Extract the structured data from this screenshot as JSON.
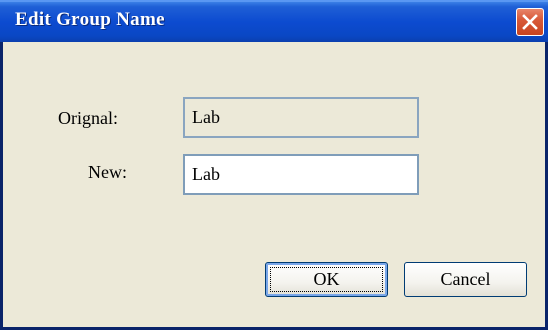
{
  "dialog": {
    "title": "Edit Group Name",
    "close_icon": "close-icon"
  },
  "form": {
    "original_label": "Orignal:",
    "original_value": "Lab",
    "new_label": "New:",
    "new_value": "Lab"
  },
  "buttons": {
    "ok_label": "OK",
    "cancel_label": "Cancel"
  },
  "colors": {
    "titlebar": "#0a47c4",
    "close_button": "#d85a3a",
    "dialog_background": "#ece9d8",
    "field_border": "#7f9db9"
  }
}
